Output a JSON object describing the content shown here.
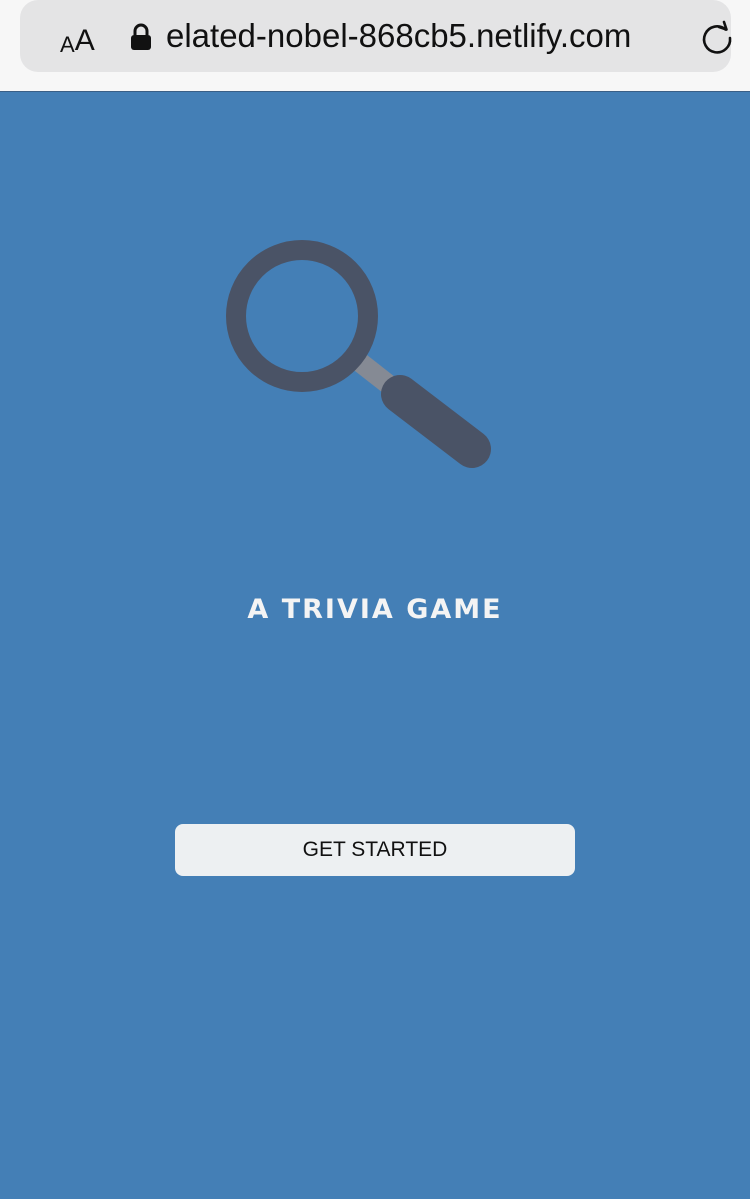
{
  "browser": {
    "text_size_small": "A",
    "text_size_large": "A",
    "url": "elated-nobel-868cb5.netlify.com",
    "lock_icon": "lock-icon",
    "reload_icon": "reload-icon"
  },
  "hero": {
    "icon": "magnifying-glass-icon",
    "subtitle": "A TRIVIA GAME"
  },
  "actions": {
    "get_started_label": "GET STARTED"
  },
  "colors": {
    "background": "#447fb6",
    "magnifier": "#4a5366",
    "magnifier_neck": "#858a94",
    "button_bg": "#edf0f2"
  }
}
